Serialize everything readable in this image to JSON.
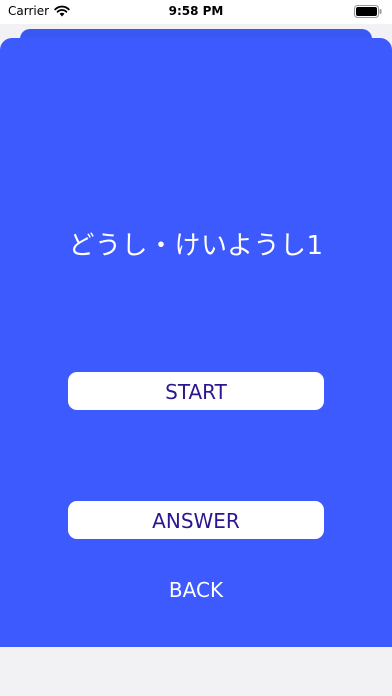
{
  "status_bar": {
    "carrier": "Carrier",
    "time": "9:58 PM",
    "icons": [
      "wifi-icon",
      "battery-icon"
    ]
  },
  "main": {
    "title": "どうし・けいようし1",
    "start_label": "START",
    "answer_label": "ANSWER",
    "back_label": "BACK"
  },
  "colors": {
    "background": "#3d5afe",
    "button_text": "#2d168f",
    "button_bg": "#ffffff"
  }
}
